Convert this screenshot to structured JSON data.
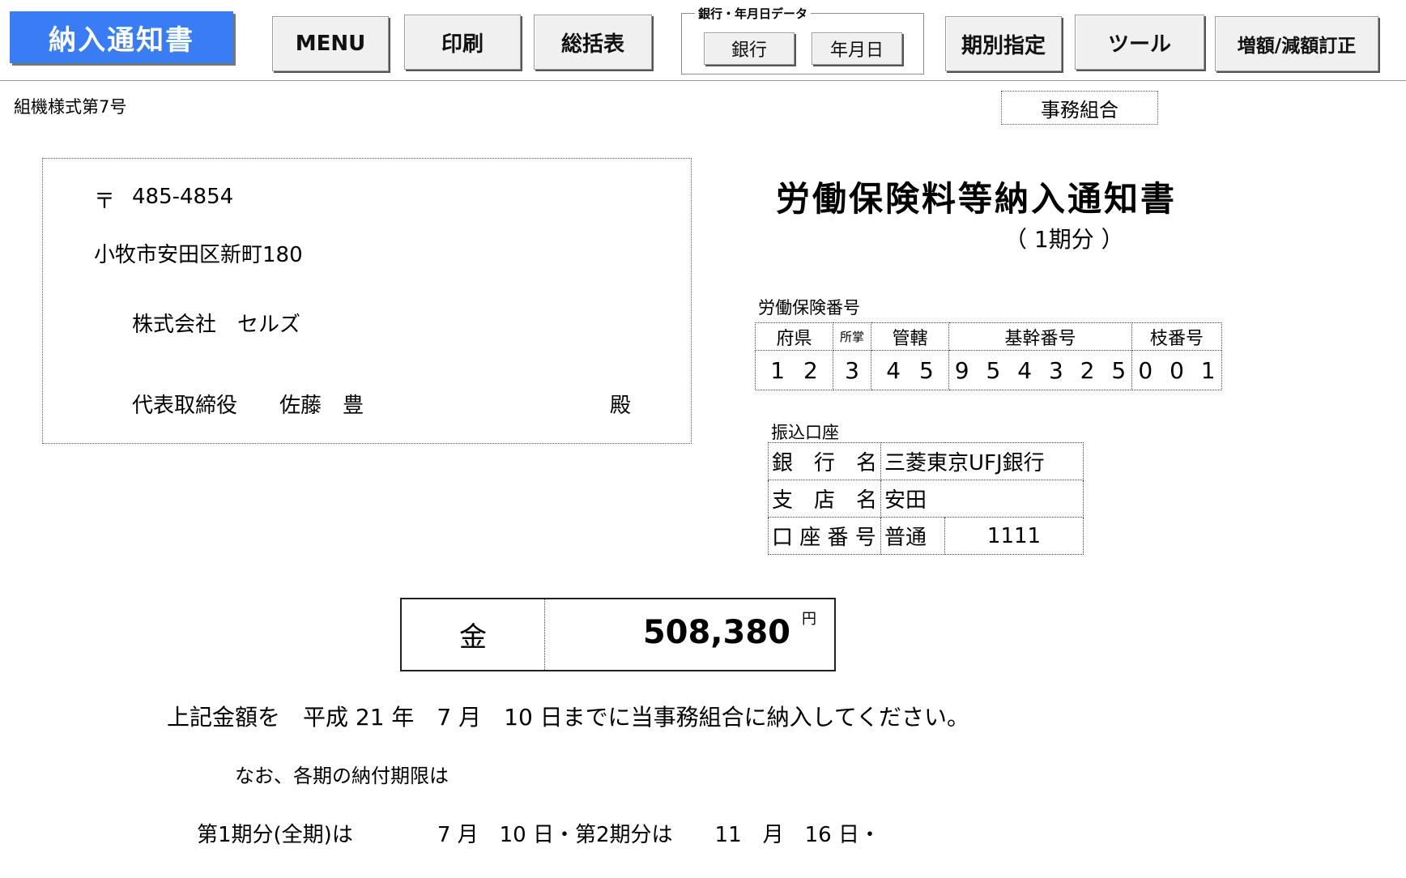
{
  "toolbar": {
    "title": "納入通知書",
    "menu": "MENU",
    "print": "印刷",
    "summary": "総括表",
    "bank_date_group": "銀行・年月日データ",
    "bank": "銀行",
    "date": "年月日",
    "period_select": "期別指定",
    "tools": "ツール",
    "correction": "増額/減額訂正"
  },
  "document": {
    "form_no": "組機様式第7号",
    "office": "事務組合",
    "address": {
      "postal_mark": "〒",
      "postal_code": "485-4854",
      "line1": "小牧市安田区新町180",
      "company": "株式会社　セルズ",
      "representative": "代表取締役　　佐藤　豊",
      "honorific": "殿"
    },
    "title": "労働保険料等納入通知書",
    "period": "（ 1期分 ）",
    "insurance": {
      "label": "労働保険番号",
      "headers": [
        "府県",
        "所掌",
        "管轄",
        "基幹番号",
        "枝番号"
      ],
      "values": [
        "1 2",
        "3",
        "4 5",
        "9 5 4 3 2 5",
        "0 0 1"
      ]
    },
    "bank_account": {
      "label": "振込口座",
      "bank_name_label": "銀　行　名",
      "bank_name": "三菱東京UFJ銀行",
      "branch_label": "支　店　名",
      "branch": "安田",
      "account_label": "口 座 番 号",
      "account_type": "普通",
      "account_number": "1111"
    },
    "amount": {
      "label": "金",
      "value": "508,380",
      "unit": "円"
    },
    "due_sentence": "上記金額を　平成 21 年　7 月　10 日までに当事務組合に納入してください。",
    "note": "なお、各期の納付期限は",
    "periods_sentence": "第1期分(全期)は　　　　7 月　10 日・第2期分は　　11　月　16 日・"
  }
}
